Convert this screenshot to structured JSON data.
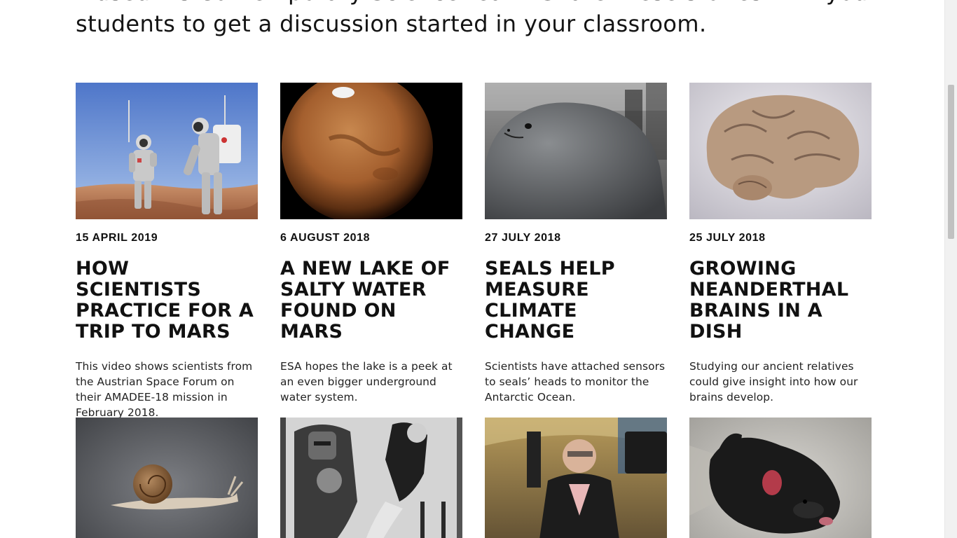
{
  "intro": {
    "line1": "Museum's Contemporary Science team. Share these stories with your",
    "line2": "students to get a discussion started in your classroom."
  },
  "cards": [
    {
      "date": "15 APRIL 2019",
      "title": "HOW SCIENTISTS PRACTICE FOR A TRIP TO MARS",
      "desc": "This video shows scientists from the Austrian Space Forum on their AMADEE-18 mission in February 2018.",
      "image": "astronauts-desert-image"
    },
    {
      "date": "6 AUGUST 2018",
      "title": "A NEW LAKE OF SALTY WATER FOUND ON MARS",
      "desc": "ESA hopes the lake is a peek at an even bigger underground water system.",
      "image": "mars-planet-image"
    },
    {
      "date": "27 JULY 2018",
      "title": "SEALS HELP MEASURE CLIMATE CHANGE",
      "desc": "Scientists have attached sensors to seals’ heads to monitor the Antarctic Ocean.",
      "image": "seal-image"
    },
    {
      "date": "25 JULY 2018",
      "title": "GROWING NEANDERTHAL BRAINS IN A DISH",
      "desc": "Studying our ancient relatives could give insight into how our brains develop.",
      "image": "brain-image"
    },
    {
      "image": "snail-image"
    },
    {
      "image": "robot-woman-image"
    },
    {
      "image": "stephen-hawking-image"
    },
    {
      "image": "tasmanian-devil-image"
    }
  ]
}
